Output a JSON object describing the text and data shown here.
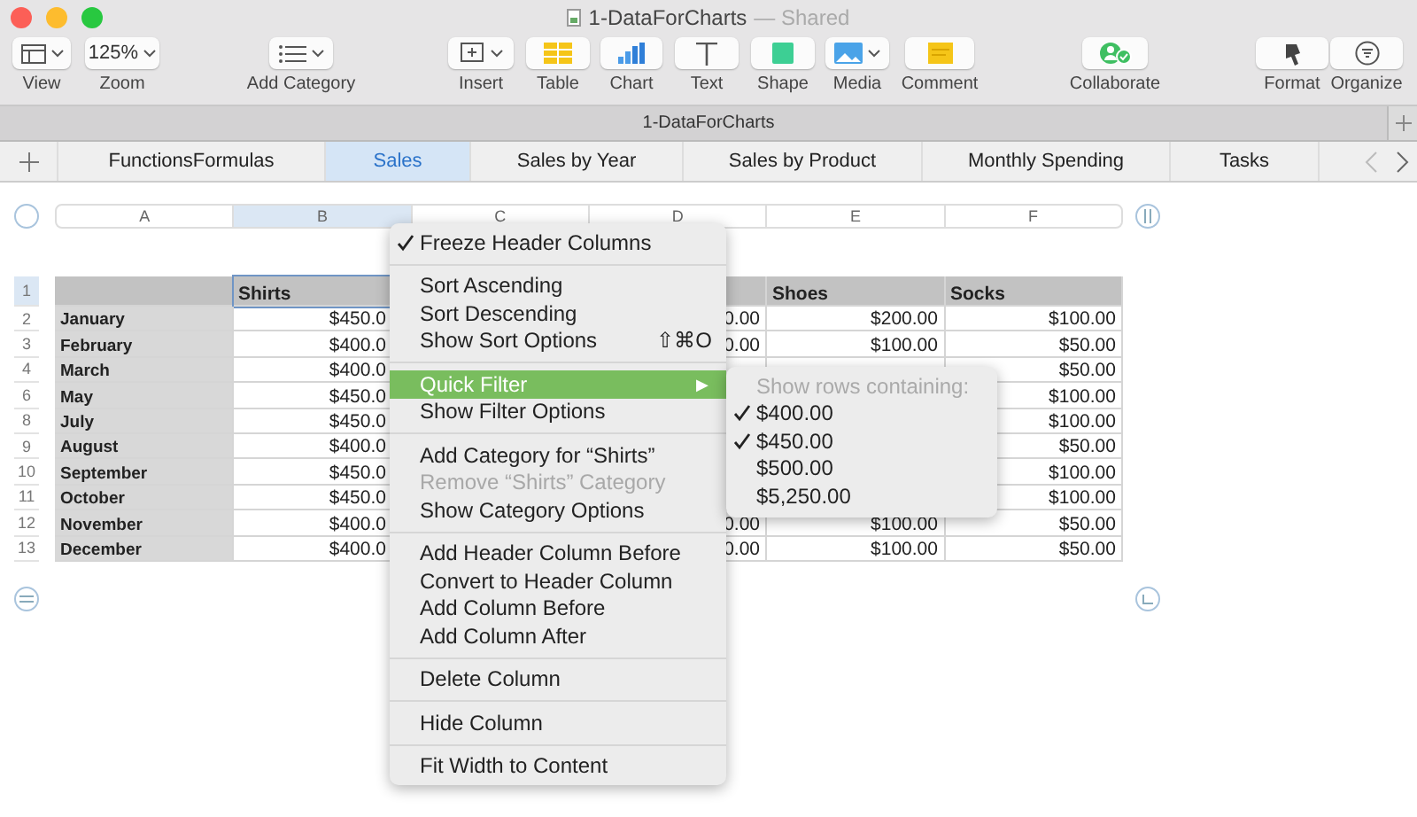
{
  "window": {
    "title": "1-DataForCharts",
    "subtitle": "— Shared"
  },
  "toolbar": [
    {
      "kind": "view",
      "label": "View",
      "dropdown": true
    },
    {
      "kind": "zoom",
      "label": "Zoom",
      "value": "125%",
      "dropdown": true
    },
    {
      "kind": "category",
      "label": "Add Category",
      "dropdown": true
    },
    {
      "kind": "insert",
      "label": "Insert",
      "dropdown": true
    },
    {
      "kind": "table",
      "label": "Table",
      "dropdown": false
    },
    {
      "kind": "chart",
      "label": "Chart",
      "dropdown": false
    },
    {
      "kind": "text",
      "label": "Text",
      "dropdown": false
    },
    {
      "kind": "shape",
      "label": "Shape",
      "dropdown": false
    },
    {
      "kind": "media",
      "label": "Media",
      "dropdown": true
    },
    {
      "kind": "comment",
      "label": "Comment",
      "dropdown": false
    },
    {
      "kind": "collaborate",
      "label": "Collaborate",
      "dropdown": false
    },
    {
      "kind": "format",
      "label": "Format",
      "dropdown": false
    },
    {
      "kind": "organize",
      "label": "Organize",
      "dropdown": false
    }
  ],
  "doc_bar": {
    "title": "1-DataForCharts"
  },
  "tabs": [
    {
      "label": "FunctionsFormulas",
      "selected": false
    },
    {
      "label": "Sales",
      "selected": true
    },
    {
      "label": "Sales by Year",
      "selected": false
    },
    {
      "label": "Sales by Product",
      "selected": false
    },
    {
      "label": "Monthly Spending",
      "selected": false
    },
    {
      "label": "Tasks",
      "selected": false
    }
  ],
  "columns": [
    {
      "letter": "A",
      "selected": false
    },
    {
      "letter": "B",
      "selected": true
    },
    {
      "letter": "C",
      "selected": false
    },
    {
      "letter": "D",
      "selected": false
    },
    {
      "letter": "E",
      "selected": false
    },
    {
      "letter": "F",
      "selected": false
    }
  ],
  "rows": [
    {
      "number": "1",
      "kind": "header",
      "b": "Shirts",
      "e": "Shoes",
      "f": "Socks"
    },
    {
      "number": "2",
      "kind": "body",
      "a": "January",
      "b": "$450.0",
      "d": "0.00",
      "e": "$200.00",
      "f": "$100.00"
    },
    {
      "number": "3",
      "kind": "body",
      "a": "February",
      "b": "$400.0",
      "d": "0.00",
      "e": "$100.00",
      "f": "$50.00"
    },
    {
      "number": "4",
      "kind": "body",
      "a": "March",
      "b": "$400.0",
      "f": "$50.00"
    },
    {
      "number": "6",
      "kind": "body",
      "a": "May",
      "b": "$450.0",
      "f": "$100.00"
    },
    {
      "number": "8",
      "kind": "body",
      "a": "July",
      "b": "$450.0",
      "f": "$100.00"
    },
    {
      "number": "9",
      "kind": "body",
      "a": "August",
      "b": "$400.0",
      "f": "$50.00"
    },
    {
      "number": "10",
      "kind": "body",
      "a": "September",
      "b": "$450.0",
      "f": "$100.00"
    },
    {
      "number": "11",
      "kind": "body",
      "a": "October",
      "b": "$450.0",
      "f": "$100.00"
    },
    {
      "number": "12",
      "kind": "body",
      "a": "November",
      "b": "$400.0",
      "d": "0.00",
      "e": "$100.00",
      "f": "$50.00"
    },
    {
      "number": "13",
      "kind": "body",
      "a": "December",
      "b": "$400.0",
      "d": "0.00",
      "e": "$100.00",
      "f": "$50.00"
    }
  ],
  "context_menu": {
    "groups": [
      [
        {
          "label": "Freeze Header Columns",
          "checked": true,
          "disabled": false,
          "selected": false
        }
      ],
      [
        {
          "label": "Sort Ascending",
          "checked": false,
          "disabled": false,
          "selected": false
        },
        {
          "label": "Sort Descending",
          "checked": false,
          "disabled": false,
          "selected": false
        },
        {
          "label": "Show Sort Options",
          "checked": false,
          "disabled": false,
          "selected": false,
          "shortcut": "⇧⌘O"
        }
      ],
      [
        {
          "label": "Quick Filter",
          "checked": false,
          "disabled": false,
          "selected": true,
          "submenu": "▶"
        },
        {
          "label": "Show Filter Options",
          "checked": false,
          "disabled": false,
          "selected": false
        }
      ],
      [
        {
          "label": "Add Category for “Shirts”",
          "checked": false,
          "disabled": false,
          "selected": false
        },
        {
          "label": "Remove “Shirts” Category",
          "checked": false,
          "disabled": true,
          "selected": false
        },
        {
          "label": "Show Category Options",
          "checked": false,
          "disabled": false,
          "selected": false
        }
      ],
      [
        {
          "label": "Add Header Column Before",
          "checked": false,
          "disabled": false,
          "selected": false
        },
        {
          "label": "Convert to Header Column",
          "checked": false,
          "disabled": false,
          "selected": false
        },
        {
          "label": "Add Column Before",
          "checked": false,
          "disabled": false,
          "selected": false
        },
        {
          "label": "Add Column After",
          "checked": false,
          "disabled": false,
          "selected": false
        }
      ],
      [
        {
          "label": "Delete Column",
          "checked": false,
          "disabled": false,
          "selected": false
        }
      ],
      [
        {
          "label": "Hide Column",
          "checked": false,
          "disabled": false,
          "selected": false
        }
      ],
      [
        {
          "label": "Fit Width to Content",
          "checked": false,
          "disabled": false,
          "selected": false
        }
      ]
    ]
  },
  "submenu": {
    "heading": "Show rows containing:",
    "options": [
      {
        "label": "$400.00",
        "checked": true
      },
      {
        "label": "$450.00",
        "checked": true
      },
      {
        "label": "$500.00",
        "checked": false
      },
      {
        "label": "$5,250.00",
        "checked": false
      }
    ]
  }
}
